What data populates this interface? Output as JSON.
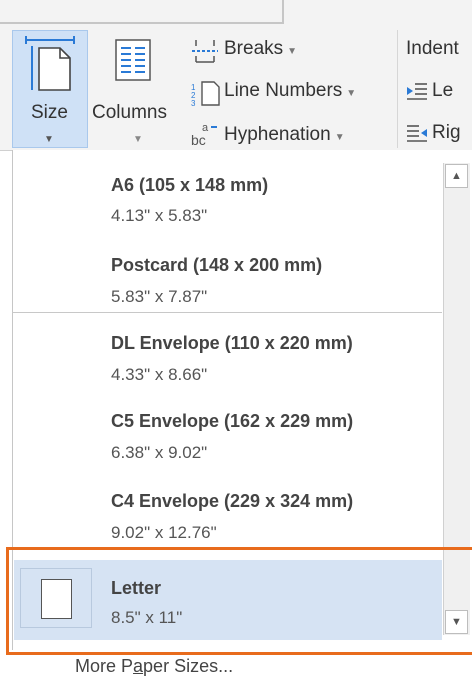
{
  "ribbon": {
    "size_label": "Size",
    "columns_label": "Columns",
    "breaks_label": "Breaks",
    "line_numbers_label": "Line Numbers",
    "hyphenation_label": "Hyphenation",
    "indent_label": "Indent",
    "indent_left_label": "Le",
    "indent_right_label": "Rig"
  },
  "paper_sizes": [
    {
      "name": "A6 (105 x 148 mm)",
      "dims": "4.13\" x 5.83\""
    },
    {
      "name": "Postcard (148 x 200 mm)",
      "dims": "5.83\" x 7.87\""
    },
    {
      "name": "DL Envelope (110 x 220 mm)",
      "dims": "4.33\" x 8.66\""
    },
    {
      "name": "C5 Envelope (162 x 229 mm)",
      "dims": "6.38\" x 9.02\""
    },
    {
      "name": "C4 Envelope (229 x 324 mm)",
      "dims": "9.02\" x 12.76\""
    },
    {
      "name": "Letter",
      "dims": "8.5\" x 11\""
    }
  ],
  "selected_index": 5,
  "more_sizes": {
    "before": "More P",
    "mnemonic": "a",
    "after": "per Sizes..."
  },
  "colors": {
    "accent_highlight": "#e86b1c",
    "selected_row": "#d6e3f3",
    "size_button_active": "#cfe1f6"
  }
}
